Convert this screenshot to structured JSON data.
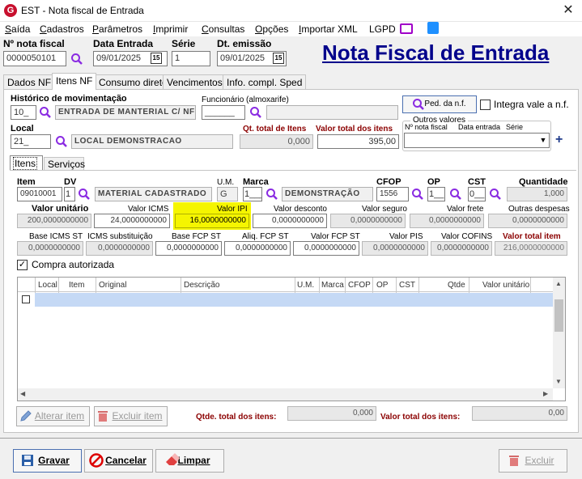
{
  "window": {
    "title": "EST - Nota fiscal de Entrada",
    "app_icon": "G",
    "close": "✕"
  },
  "menu": [
    {
      "label": "Saída",
      "u": "S",
      "rest": "aída"
    },
    {
      "label": "Cadastros",
      "u": "C",
      "rest": "adastros"
    },
    {
      "label": "Parâmetros",
      "u": "P",
      "rest": "arâmetros"
    },
    {
      "label": "Imprimir",
      "u": "I",
      "rest": "mprimir"
    },
    {
      "label": "Consultas",
      "u": "C",
      "rest": "onsultas"
    },
    {
      "label": "Opções",
      "u": "O",
      "rest": "pções"
    },
    {
      "label": "Importar XML",
      "u": "I",
      "rest": "mportar XML"
    },
    {
      "label": "LGPD",
      "u": "",
      "rest": "LGPD"
    }
  ],
  "header": {
    "nota_label": "Nº nota fiscal",
    "nota_value": "0000050101",
    "data_entrada_label": "Data Entrada",
    "data_entrada_value": "09/01/2025",
    "serie_label": "Série",
    "serie_value": "1",
    "dt_emissao_label": "Dt. emissão",
    "dt_emissao_value": "09/01/2025",
    "cal_icon": "15",
    "big_title": "Nota Fiscal de Entrada"
  },
  "tabs": [
    "Dados NF",
    "Itens NF",
    "Consumo direto",
    "Vencimentos",
    "Info. compl. Sped"
  ],
  "nf": {
    "historico_label": "Histórico de movimentação",
    "historico_code": "10_",
    "historico_desc": "ENTRADA DE MANTERIAL C/ NF",
    "funcionario_label": "Funcionário (almoxarife)",
    "funcionario_code": "______",
    "funcionario_name": "",
    "ped_button": "Ped. da n.f.",
    "integra_label": "Integra vale a n.f.",
    "local_label": "Local",
    "local_code": "21_",
    "local_desc": "LOCAL DEMONSTRACAO",
    "qt_total_label": "Qt. total de Itens",
    "qt_total_value": "0,000",
    "valor_total_label": "Valor total dos itens",
    "valor_total_value": "395,00",
    "outros_label": "Outros valores",
    "outros_cols": [
      "Nº nota fiscal",
      "Data entrada",
      "Série"
    ],
    "plus": "+"
  },
  "subtabs": [
    "Itens",
    "Serviços"
  ],
  "item": {
    "item_label": "Item",
    "item_value": "09010001",
    "dv_label": "DV",
    "dv_value": "1",
    "desc_value": "MATERIAL CADASTRADO",
    "um_label": "U.M.",
    "um_value": "G",
    "marca_label": "Marca",
    "marca_code": "1___",
    "marca_desc": "DEMONSTRAÇÃO",
    "cfop_label": "CFOP",
    "cfop_value": "1556",
    "op_label": "OP",
    "op_value": "1__",
    "cst_label": "CST",
    "cst_value": "0__",
    "qtd_label": "Quantidade",
    "qtd_value": "1,000"
  },
  "row2": [
    {
      "label": "Valor unitário",
      "value": "200,0000000000",
      "bold": true
    },
    {
      "label": "Valor ICMS",
      "value": "24,0000000000"
    },
    {
      "label": "Valor IPI",
      "value": "16,0000000000",
      "highlight": true
    },
    {
      "label": "Valor desconto",
      "value": "0,0000000000"
    },
    {
      "label": "Valor seguro",
      "value": "0,0000000000"
    },
    {
      "label": "Valor frete",
      "value": "0,0000000000"
    },
    {
      "label": "Outras despesas",
      "value": "0,0000000000"
    }
  ],
  "row3": [
    {
      "label": "Base ICMS ST",
      "value": "0,0000000000"
    },
    {
      "label": "ICMS substituição",
      "value": "0,0000000000"
    },
    {
      "label": "Base FCP ST",
      "value": "0,0000000000"
    },
    {
      "label": "Aliq. FCP ST",
      "value": "0,0000000000"
    },
    {
      "label": "Valor FCP ST",
      "value": "0,0000000000"
    },
    {
      "label": "Valor PIS",
      "value": "0,0000000000"
    },
    {
      "label": "Valor COFINS",
      "value": "0,0000000000"
    },
    {
      "label": "Valor total item",
      "value": "216,0000000000"
    }
  ],
  "compra_label": "Compra autorizada",
  "grid_cols": [
    "Local",
    "Item",
    "Original",
    "Descrição",
    "U.M.",
    "Marca",
    "CFOP",
    "OP",
    "CST",
    "Qtde",
    "Valor unitário"
  ],
  "bottom": {
    "alterar": "Alterar item",
    "excluir_item": "Excluir item",
    "qtde_total_label": "Qtde. total dos itens:",
    "qtde_total_value": "0,000",
    "valor_total_label": "Valor total dos itens:",
    "valor_total_value": "0,00"
  },
  "footer": {
    "gravar": "Gravar",
    "cancelar": "Cancelar",
    "limpar": "Limpar",
    "excluir": "Excluir"
  },
  "colors": {
    "title_blue": "#00008b",
    "highlight": "#f5f500",
    "accent": "#8b0000"
  }
}
